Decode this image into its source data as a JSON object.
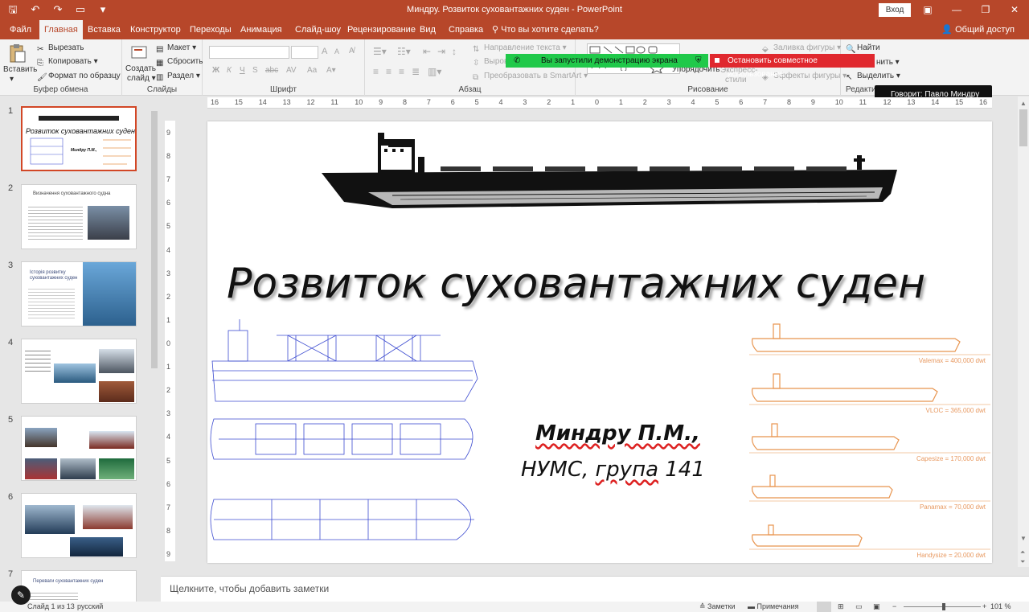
{
  "window": {
    "title": "Миндру. Розвиток суховантажних суден  -  PowerPoint",
    "login_label": "Вход"
  },
  "tabs": [
    {
      "label": "Файл"
    },
    {
      "label": "Главная"
    },
    {
      "label": "Вставка"
    },
    {
      "label": "Конструктор"
    },
    {
      "label": "Переходы"
    },
    {
      "label": "Анимация"
    },
    {
      "label": "Слайд-шоу"
    },
    {
      "label": "Рецензирование"
    },
    {
      "label": "Вид"
    },
    {
      "label": "Справка"
    },
    {
      "label": "Что вы хотите сделать?"
    }
  ],
  "share_label": "Общий доступ",
  "ribbon": {
    "clipboard": {
      "paste": "Вставить",
      "cut": "Вырезать",
      "copy": "Копировать",
      "format_painter": "Формат по образцу",
      "label": "Буфер обмена"
    },
    "slides": {
      "new_slide_line1": "Создать",
      "new_slide_line2": "слайд",
      "layout": "Макет",
      "reset": "Сбросить",
      "section": "Раздел",
      "label": "Слайды"
    },
    "font": {
      "label": "Шрифт",
      "bold": "Ж",
      "italic": "К",
      "underline": "Ч",
      "strike": "S",
      "abc": "abc",
      "av": "AV",
      "aa": "Aa",
      "grow": "A",
      "shrink": "A"
    },
    "paragraph": {
      "label": "Абзац",
      "text_direction": "Направление текста",
      "align_text": "Выров",
      "smartart": "Преобразовать в SmartArt"
    },
    "drawing": {
      "label": "Рисование",
      "arrange": "Упорядочить",
      "quick_styles_1": "Экспресс-",
      "quick_styles_2": "стили",
      "fill": "Заливка фигуры",
      "effects": "Эффекты фигуры"
    },
    "editing": {
      "label": "Редактир",
      "find": "Найти",
      "replace": "нить",
      "select": "Выделить"
    }
  },
  "notifications": {
    "screen_share": "Вы запустили демонстрацию экрана",
    "stop_sharing": "Остановить совместное использование",
    "speaker": "Говорит: Павло Миндру"
  },
  "thumbnails": [
    {
      "num": "1",
      "title": "Розвиток суховантажних суден",
      "subtitle": "Миндру П.М.,"
    },
    {
      "num": "2",
      "title": "Визначення суховантажного судна"
    },
    {
      "num": "3",
      "title": "Історія розвитку суховантажних суден"
    },
    {
      "num": "4",
      "title": ""
    },
    {
      "num": "5",
      "title": ""
    },
    {
      "num": "6",
      "title": ""
    },
    {
      "num": "7",
      "title": "Переваги суховантажних суден"
    }
  ],
  "slide": {
    "title": "Розвиток суховантажних суден",
    "author": "Миндру П.М.,",
    "group_prefix": "НУМС, ",
    "group_word": "група",
    "group_number": " 141",
    "ship_types": [
      {
        "label": "Valemax = 400,000 dwt"
      },
      {
        "label": "VLOC = 365,000 dwt"
      },
      {
        "label": "Capesize = 170,000 dwt"
      },
      {
        "label": "Panamax = 70,000 dwt"
      },
      {
        "label": "Handysize = 20,000 dwt"
      }
    ]
  },
  "ruler_h": [
    "16",
    "15",
    "14",
    "13",
    "12",
    "11",
    "10",
    "9",
    "8",
    "7",
    "6",
    "5",
    "4",
    "3",
    "2",
    "1",
    "0",
    "1",
    "2",
    "3",
    "4",
    "5",
    "6",
    "7",
    "8",
    "9",
    "10",
    "11",
    "12",
    "13",
    "14",
    "15",
    "16"
  ],
  "ruler_v": [
    "9",
    "8",
    "7",
    "6",
    "5",
    "4",
    "3",
    "2",
    "1",
    "0",
    "1",
    "2",
    "3",
    "4",
    "5",
    "6",
    "7",
    "8",
    "9"
  ],
  "notes_placeholder": "Щелкните, чтобы добавить заметки",
  "status": {
    "slide_info": "Слайд 1 из 13",
    "language": "русский",
    "notes": "Заметки",
    "comments": "Примечания",
    "zoom": "101 %"
  },
  "colors": {
    "accent": "#b7472a",
    "selected_thumb": "#d24726",
    "green": "#20c94a",
    "red": "#e0282e",
    "orange_lines": "#e8944e"
  }
}
